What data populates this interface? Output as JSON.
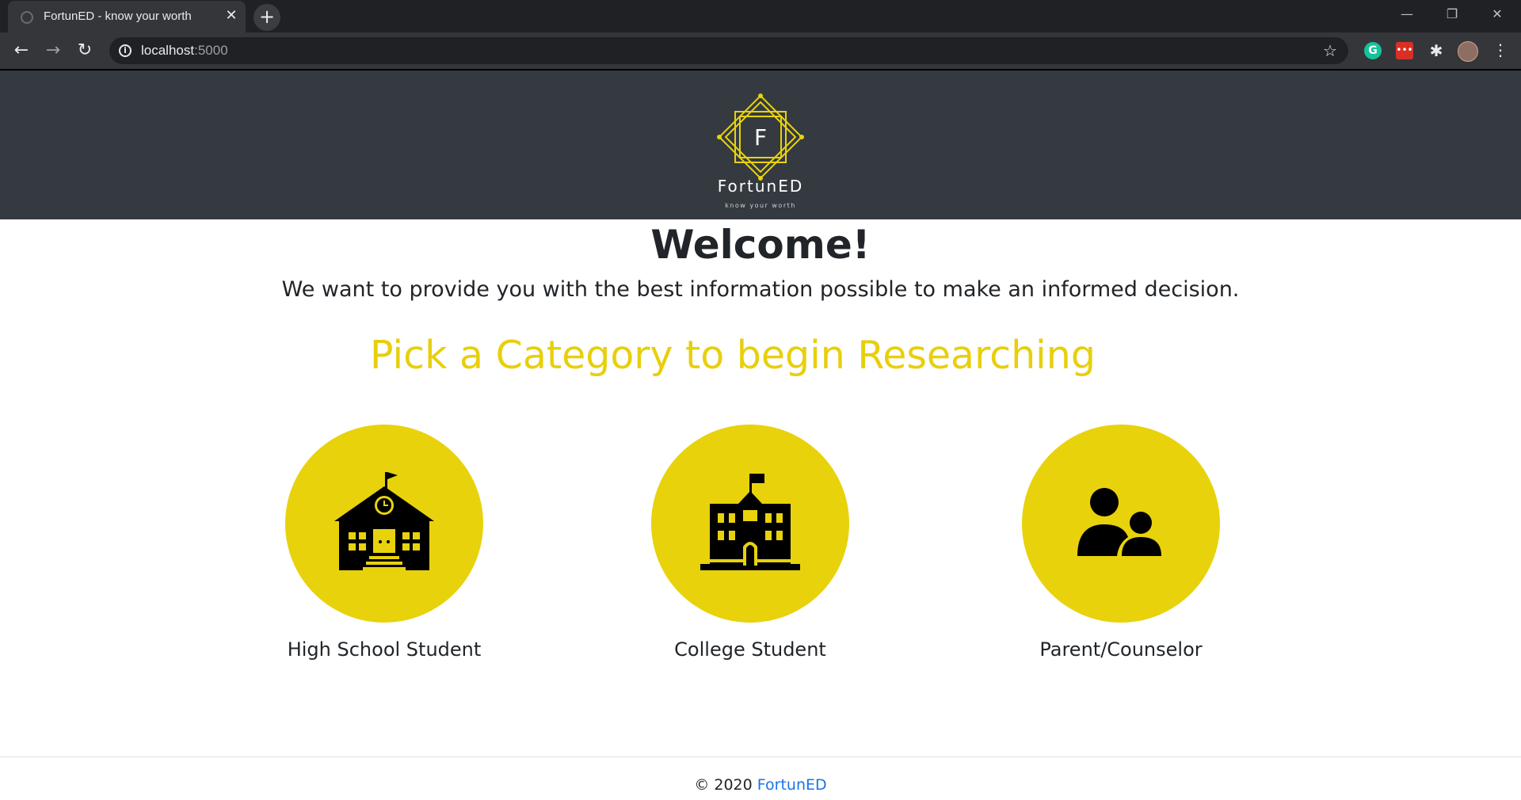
{
  "browser": {
    "tab_title": "FortunED - know your worth",
    "tab_close": "✕",
    "new_tab": "+",
    "url_host": "localhost",
    "url_port": ":5000",
    "window_controls": {
      "minimize": "—",
      "maximize": "❐",
      "close": "✕"
    },
    "extensions": {
      "grammarly": "G",
      "red": "•••"
    }
  },
  "header": {
    "logo_letter": "F",
    "brand_name": "FortunED",
    "tagline": "know your worth",
    "accent_color": "#e8d20c"
  },
  "main": {
    "welcome": "Welcome!",
    "subtitle": "We want to provide you with the best information possible to make an informed decision.",
    "category_heading": "Pick a Category to begin Researching",
    "categories": [
      {
        "label": "High School Student",
        "icon": "high-school-icon"
      },
      {
        "label": "College Student",
        "icon": "college-icon"
      },
      {
        "label": "Parent/Counselor",
        "icon": "parent-counselor-icon"
      }
    ]
  },
  "footer": {
    "copyright": "© 2020",
    "brand_link": "FortunED"
  }
}
